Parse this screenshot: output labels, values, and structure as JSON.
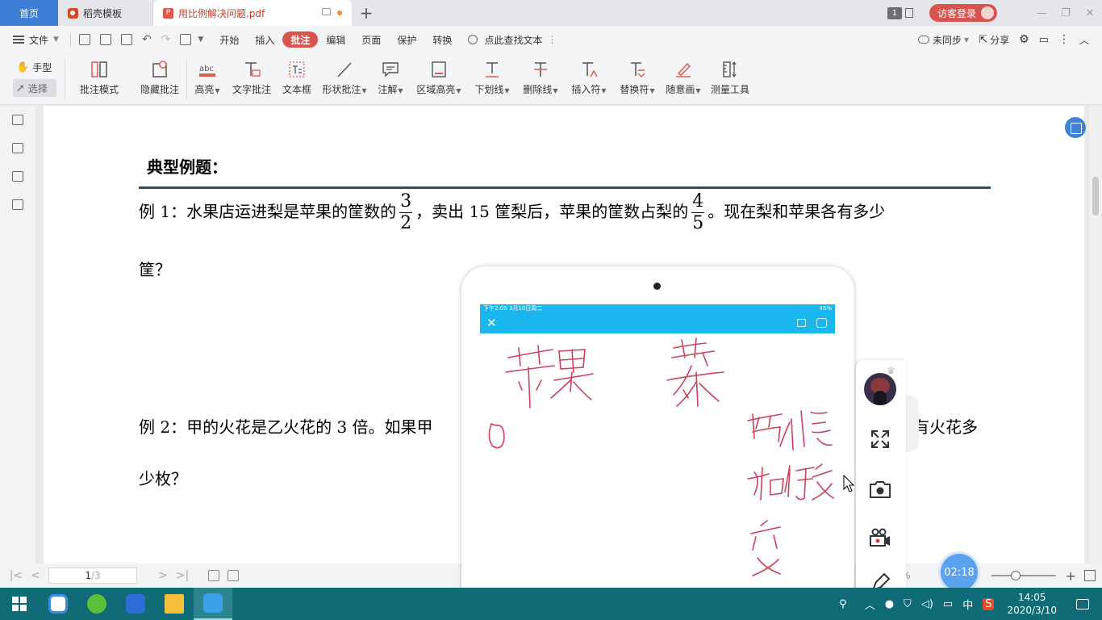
{
  "tabs": {
    "home": "首页",
    "template": "稻壳模板",
    "doc": "用比例解决问题.pdf",
    "add": "+"
  },
  "titlebar": {
    "badge": "1",
    "login": "访客登录"
  },
  "menubar": {
    "file": "文件",
    "tabs": [
      "开始",
      "插入",
      "批注",
      "编辑",
      "页面",
      "保护",
      "转换"
    ],
    "active_tab": "批注",
    "search": "点此查找文本",
    "sync": "未同步",
    "share": "分享"
  },
  "ribbon": {
    "hand": "手型",
    "select": "选择",
    "tools": [
      {
        "label": "批注模式",
        "icon": "annotation-mode-icon"
      },
      {
        "label": "隐藏批注",
        "icon": "hide-annotation-icon"
      },
      {
        "label": "高亮",
        "icon": "highlight-icon",
        "dropdown": true
      },
      {
        "label": "文字批注",
        "icon": "text-annotation-icon"
      },
      {
        "label": "文本框",
        "icon": "textbox-icon"
      },
      {
        "label": "形状批注",
        "icon": "shape-annotation-icon",
        "dropdown": true
      },
      {
        "label": "注解",
        "icon": "note-icon",
        "dropdown": true
      },
      {
        "label": "区域高亮",
        "icon": "area-highlight-icon",
        "dropdown": true
      },
      {
        "label": "下划线",
        "icon": "underline-icon",
        "dropdown": true
      },
      {
        "label": "删除线",
        "icon": "strikethrough-icon",
        "dropdown": true
      },
      {
        "label": "插入符",
        "icon": "insert-caret-icon",
        "dropdown": true
      },
      {
        "label": "替换符",
        "icon": "replace-caret-icon",
        "dropdown": true
      },
      {
        "label": "随意画",
        "icon": "freehand-icon",
        "dropdown": true
      },
      {
        "label": "测量工具",
        "icon": "measure-icon"
      }
    ]
  },
  "document": {
    "section_title": "典型例题：",
    "ex1_a": "例 1：水果店运进梨是苹果的筐数的",
    "ex1_frac1_num": "3",
    "ex1_frac1_den": "2",
    "ex1_b": "，卖出 15 筐梨后，苹果的筐数占梨的",
    "ex1_frac2_num": "4",
    "ex1_frac2_den": "5",
    "ex1_c": "。现在梨和苹果各有多少",
    "ex1_line2": "筐？",
    "ex2_a": "例 2：甲的火花是乙火花的 3 倍。如果甲",
    "ex2_b": "有火花多",
    "ex2_line2": "少枚？"
  },
  "statusbar": {
    "page_current": "1",
    "page_total": "/3",
    "zoom_suffix": "%"
  },
  "phone": {
    "status_left": "下午2:05  3月10日周二",
    "status_right": "45%"
  },
  "timer": "02:18",
  "taskbar": {
    "ime": "中",
    "time": "14:05",
    "date": "2020/3/10"
  },
  "colors": {
    "accent_red": "#d9534f",
    "tab_blue": "#3d7fd6",
    "phone_bar": "#1ab7ef",
    "ink": "#d0405a",
    "taskbar": "#0f6b76"
  }
}
